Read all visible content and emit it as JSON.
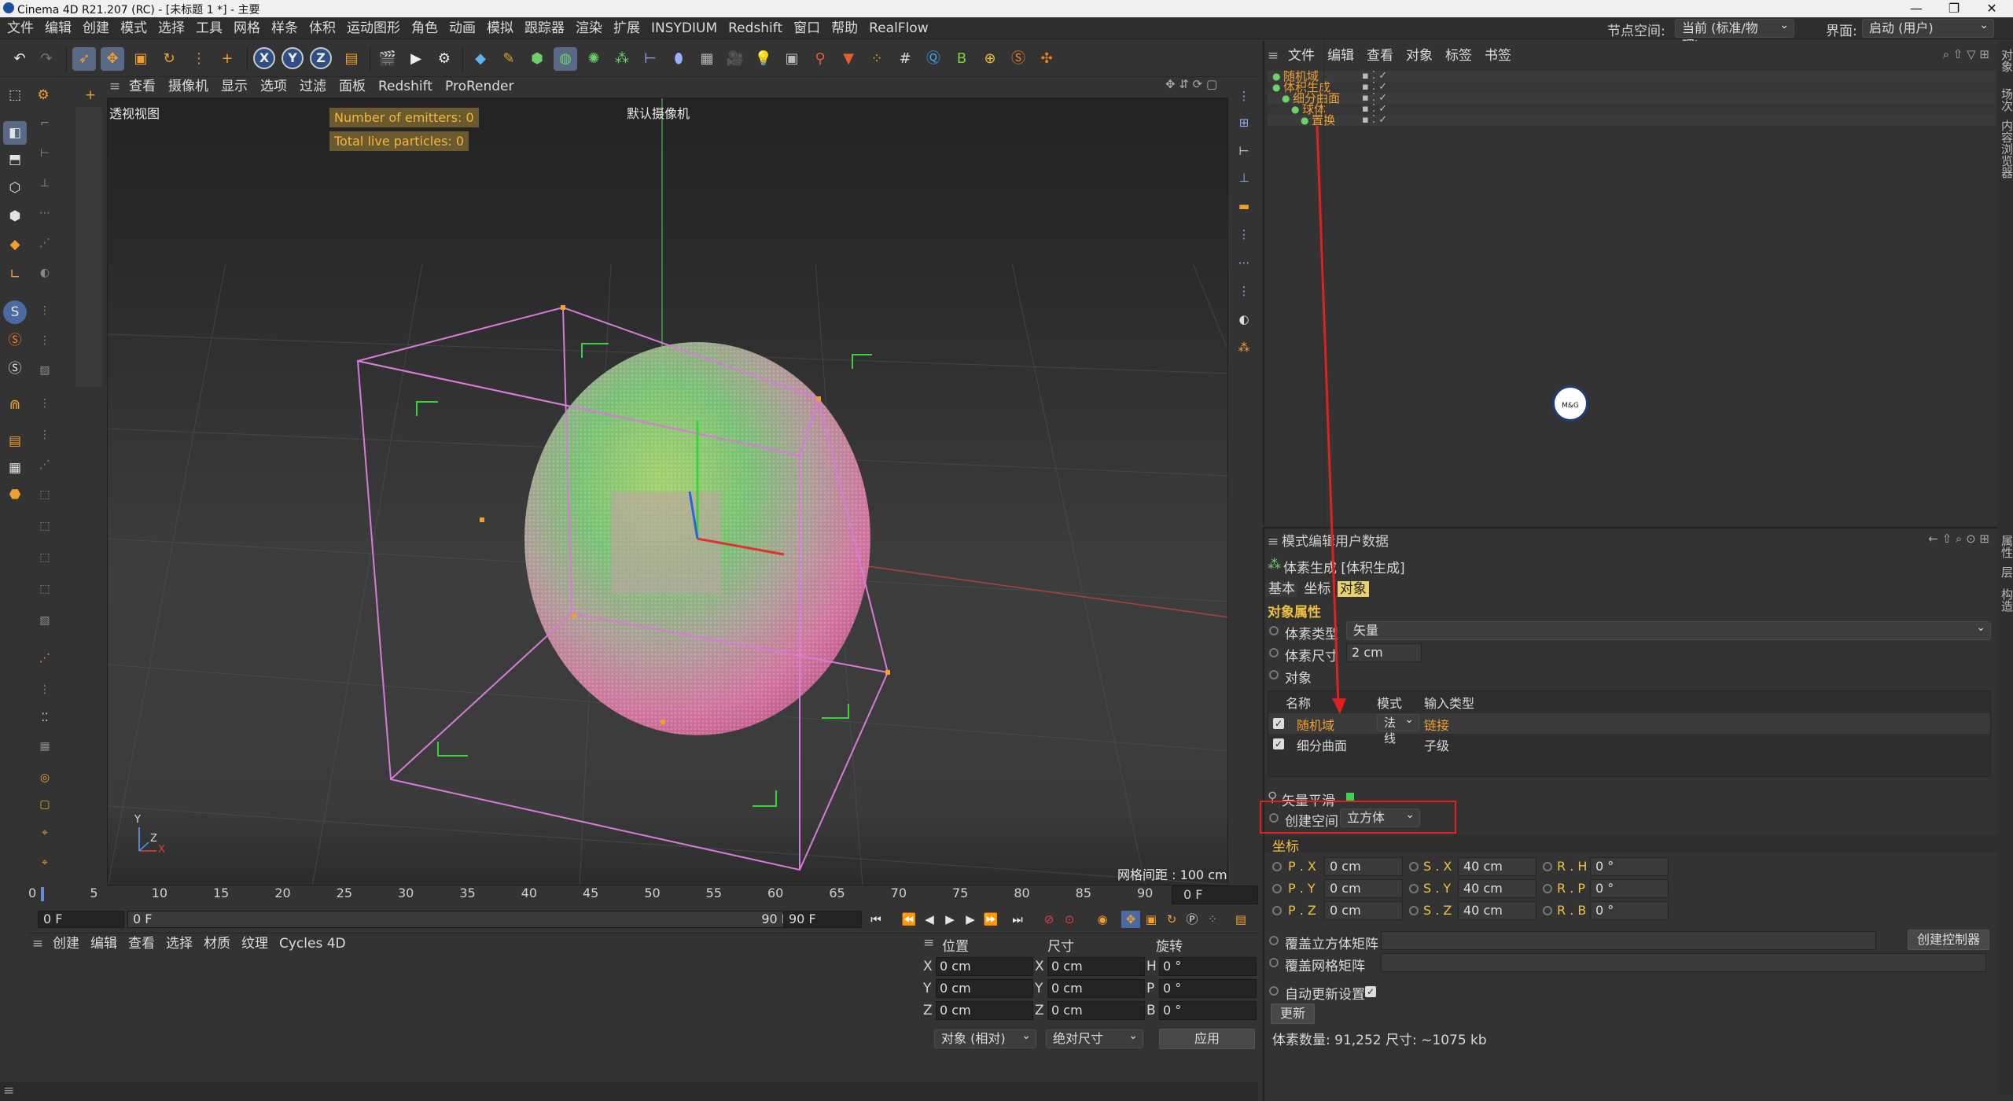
{
  "window": {
    "title": "Cinema 4D R21.207 (RC) - [未标题 1 *] - 主要",
    "controls": [
      "—",
      "❐",
      "✕"
    ]
  },
  "menubar": {
    "items": [
      "文件",
      "编辑",
      "创建",
      "模式",
      "选择",
      "工具",
      "网格",
      "样条",
      "体积",
      "运动图形",
      "角色",
      "动画",
      "模拟",
      "跟踪器",
      "渲染",
      "扩展",
      "INSYDIUM",
      "Redshift",
      "窗口",
      "帮助",
      "RealFlow"
    ],
    "node_space_label": "节点空间:",
    "node_space_value": "当前 (标准/物理)",
    "interface_label": "界面:",
    "interface_value": "启动 (用户)"
  },
  "toolbar": {
    "axis_x": "X",
    "axis_y": "Y",
    "axis_z": "Z"
  },
  "viewport": {
    "menu": [
      "查看",
      "摄像机",
      "显示",
      "选项",
      "过滤",
      "面板",
      "Redshift",
      "ProRender"
    ],
    "view_name": "透视视图",
    "camera_name": "默认摄像机",
    "hud_emitters": "Number of emitters: 0",
    "hud_particles": "Total live particles: 0",
    "grid_spacing": "网格间距 : 100 cm",
    "axis_y": "Y",
    "axis_z": "Z",
    "axis_x": "X"
  },
  "timeline": {
    "ticks": [
      "0",
      "5",
      "10",
      "15",
      "20",
      "25",
      "30",
      "35",
      "40",
      "45",
      "50",
      "55",
      "60",
      "65",
      "70",
      "75",
      "80",
      "85",
      "90"
    ],
    "current_frame": "0 F",
    "start_frame": "0 F",
    "range_start": "0 F",
    "range_end": "90 F",
    "end_frame": "90 F"
  },
  "material_panel": {
    "menu": [
      "创建",
      "编辑",
      "查看",
      "选择",
      "材质",
      "纹理",
      "Cycles 4D"
    ]
  },
  "coordinates": {
    "headers": [
      "位置",
      "尺寸",
      "旋转"
    ],
    "rows": [
      {
        "axis": "X",
        "pos": "0 cm",
        "size_axis": "X",
        "size": "0 cm",
        "rot_axis": "H",
        "rot": "0 °"
      },
      {
        "axis": "Y",
        "pos": "0 cm",
        "size_axis": "Y",
        "size": "0 cm",
        "rot_axis": "P",
        "rot": "0 °"
      },
      {
        "axis": "Z",
        "pos": "0 cm",
        "size_axis": "Z",
        "size": "0 cm",
        "rot_axis": "B",
        "rot": "0 °"
      }
    ],
    "mode": "对象 (相对)",
    "size_mode": "绝对尺寸",
    "apply": "应用"
  },
  "object_manager": {
    "menu": [
      "文件",
      "编辑",
      "查看",
      "对象",
      "标签",
      "书签"
    ],
    "objects": [
      {
        "name": "随机域",
        "indent": 0
      },
      {
        "name": "体积生成",
        "indent": 0
      },
      {
        "name": "细分曲面",
        "indent": 1
      },
      {
        "name": "球体",
        "indent": 2
      },
      {
        "name": "置换",
        "indent": 3
      }
    ],
    "watermark": "M&G"
  },
  "attribute_manager": {
    "menu": [
      "模式",
      "编辑",
      "用户数据"
    ],
    "object_title": "体素生成 [体积生成]",
    "tabs": [
      "基本",
      "坐标",
      "对象"
    ],
    "section": "对象属性",
    "voxel_type_label": "体素类型",
    "voxel_type_value": "矢量",
    "voxel_size_label": "体素尺寸",
    "voxel_size_value": "2 cm",
    "objects_label": "对象",
    "list_headers": [
      "名称",
      "模式",
      "输入类型"
    ],
    "list_rows": [
      {
        "name": "随机域",
        "mode": "法线",
        "input": "链接"
      },
      {
        "name": "细分曲面",
        "mode": "",
        "input": "子级"
      }
    ],
    "vector_smooth": "矢量平滑",
    "create_space_label": "创建空间",
    "create_space_value": "立方体",
    "coord_section": "坐标",
    "px": "0 cm",
    "py": "0 cm",
    "pz": "0 cm",
    "sx": "40 cm",
    "sy": "40 cm",
    "sz": "40 cm",
    "rh": "0 °",
    "rp": "0 °",
    "rb": "0 °",
    "labels": {
      "px": "P . X",
      "py": "P . Y",
      "pz": "P . Z",
      "sx": "S . X",
      "sy": "S . Y",
      "sz": "S . Z",
      "rh": "R . H",
      "rp": "R . P",
      "rb": "R . B"
    },
    "override_cube": "覆盖立方体矩阵",
    "create_controller": "创建控制器",
    "override_grid": "覆盖网格矩阵",
    "auto_update": "自动更新设置",
    "update_btn": "更新",
    "voxel_stats": "体素数量: 91,252   尺寸: ~1075 kb"
  },
  "edge_tabs": [
    "对象",
    "场次",
    "内容浏览器",
    "属性",
    "层",
    "构造"
  ],
  "colors": {
    "object_orange": "#f0a030",
    "highlight_tab": "#e8d16b",
    "annotation_red": "#e02020",
    "cage_pink": "#d87ad8",
    "hud_text": "#f5b73c"
  }
}
